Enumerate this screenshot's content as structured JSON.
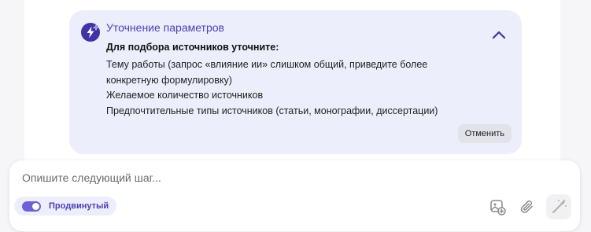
{
  "card": {
    "title": "Уточнение параметров",
    "subtitle": "Для подбора источников уточните:",
    "lines": [
      "Тему работы (запрос «влияние ии» слишком общий, приведите более конкретную формулировку)",
      "Желаемое количество источников",
      "Предпочтительные типы источников (статьи, монографии, диссертации)"
    ],
    "cancel_label": "Отменить",
    "icon": "lightning-sparkle-icon",
    "collapse_icon": "chevron-up-icon"
  },
  "composer": {
    "placeholder": "Опишите следующий шаг...",
    "mode_label": "Продвинутый",
    "mode_enabled": true,
    "tools": [
      "image-add-icon",
      "paperclip-icon",
      "magic-wand-icon"
    ]
  },
  "colors": {
    "accent": "#4b3fb3",
    "card_background": "#eceefc",
    "toggle": "#6d5fd6"
  }
}
